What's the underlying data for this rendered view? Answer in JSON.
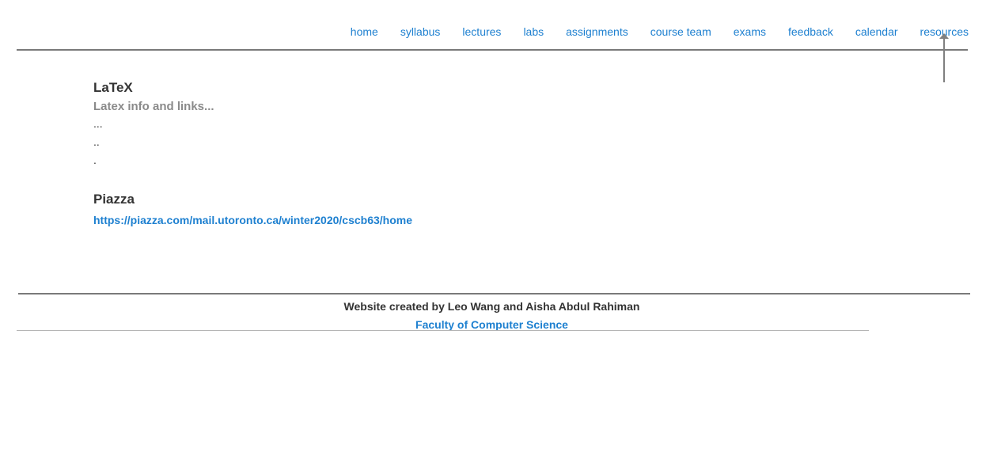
{
  "nav": {
    "items": [
      {
        "label": "home"
      },
      {
        "label": "syllabus"
      },
      {
        "label": "lectures"
      },
      {
        "label": "labs"
      },
      {
        "label": "assignments"
      },
      {
        "label": "course team"
      },
      {
        "label": "exams"
      },
      {
        "label": "feedback"
      },
      {
        "label": "calendar"
      },
      {
        "label": "resources"
      }
    ]
  },
  "main": {
    "latex": {
      "title": "LaTeX",
      "description": "Latex info and links...",
      "dots": [
        "...",
        "..",
        "."
      ]
    },
    "piazza": {
      "title": "Piazza",
      "link": "https://piazza.com/mail.utoronto.ca/winter2020/cscb63/home"
    }
  },
  "footer": {
    "credit": "Website created by Leo Wang and Aisha Abdul Rahiman",
    "faculty_link": "Faculty of Computer Science"
  },
  "colors": {
    "link": "#1e80d0",
    "heading": "#333333",
    "muted": "#8a8a8a",
    "rule": "#7a7a7a"
  }
}
